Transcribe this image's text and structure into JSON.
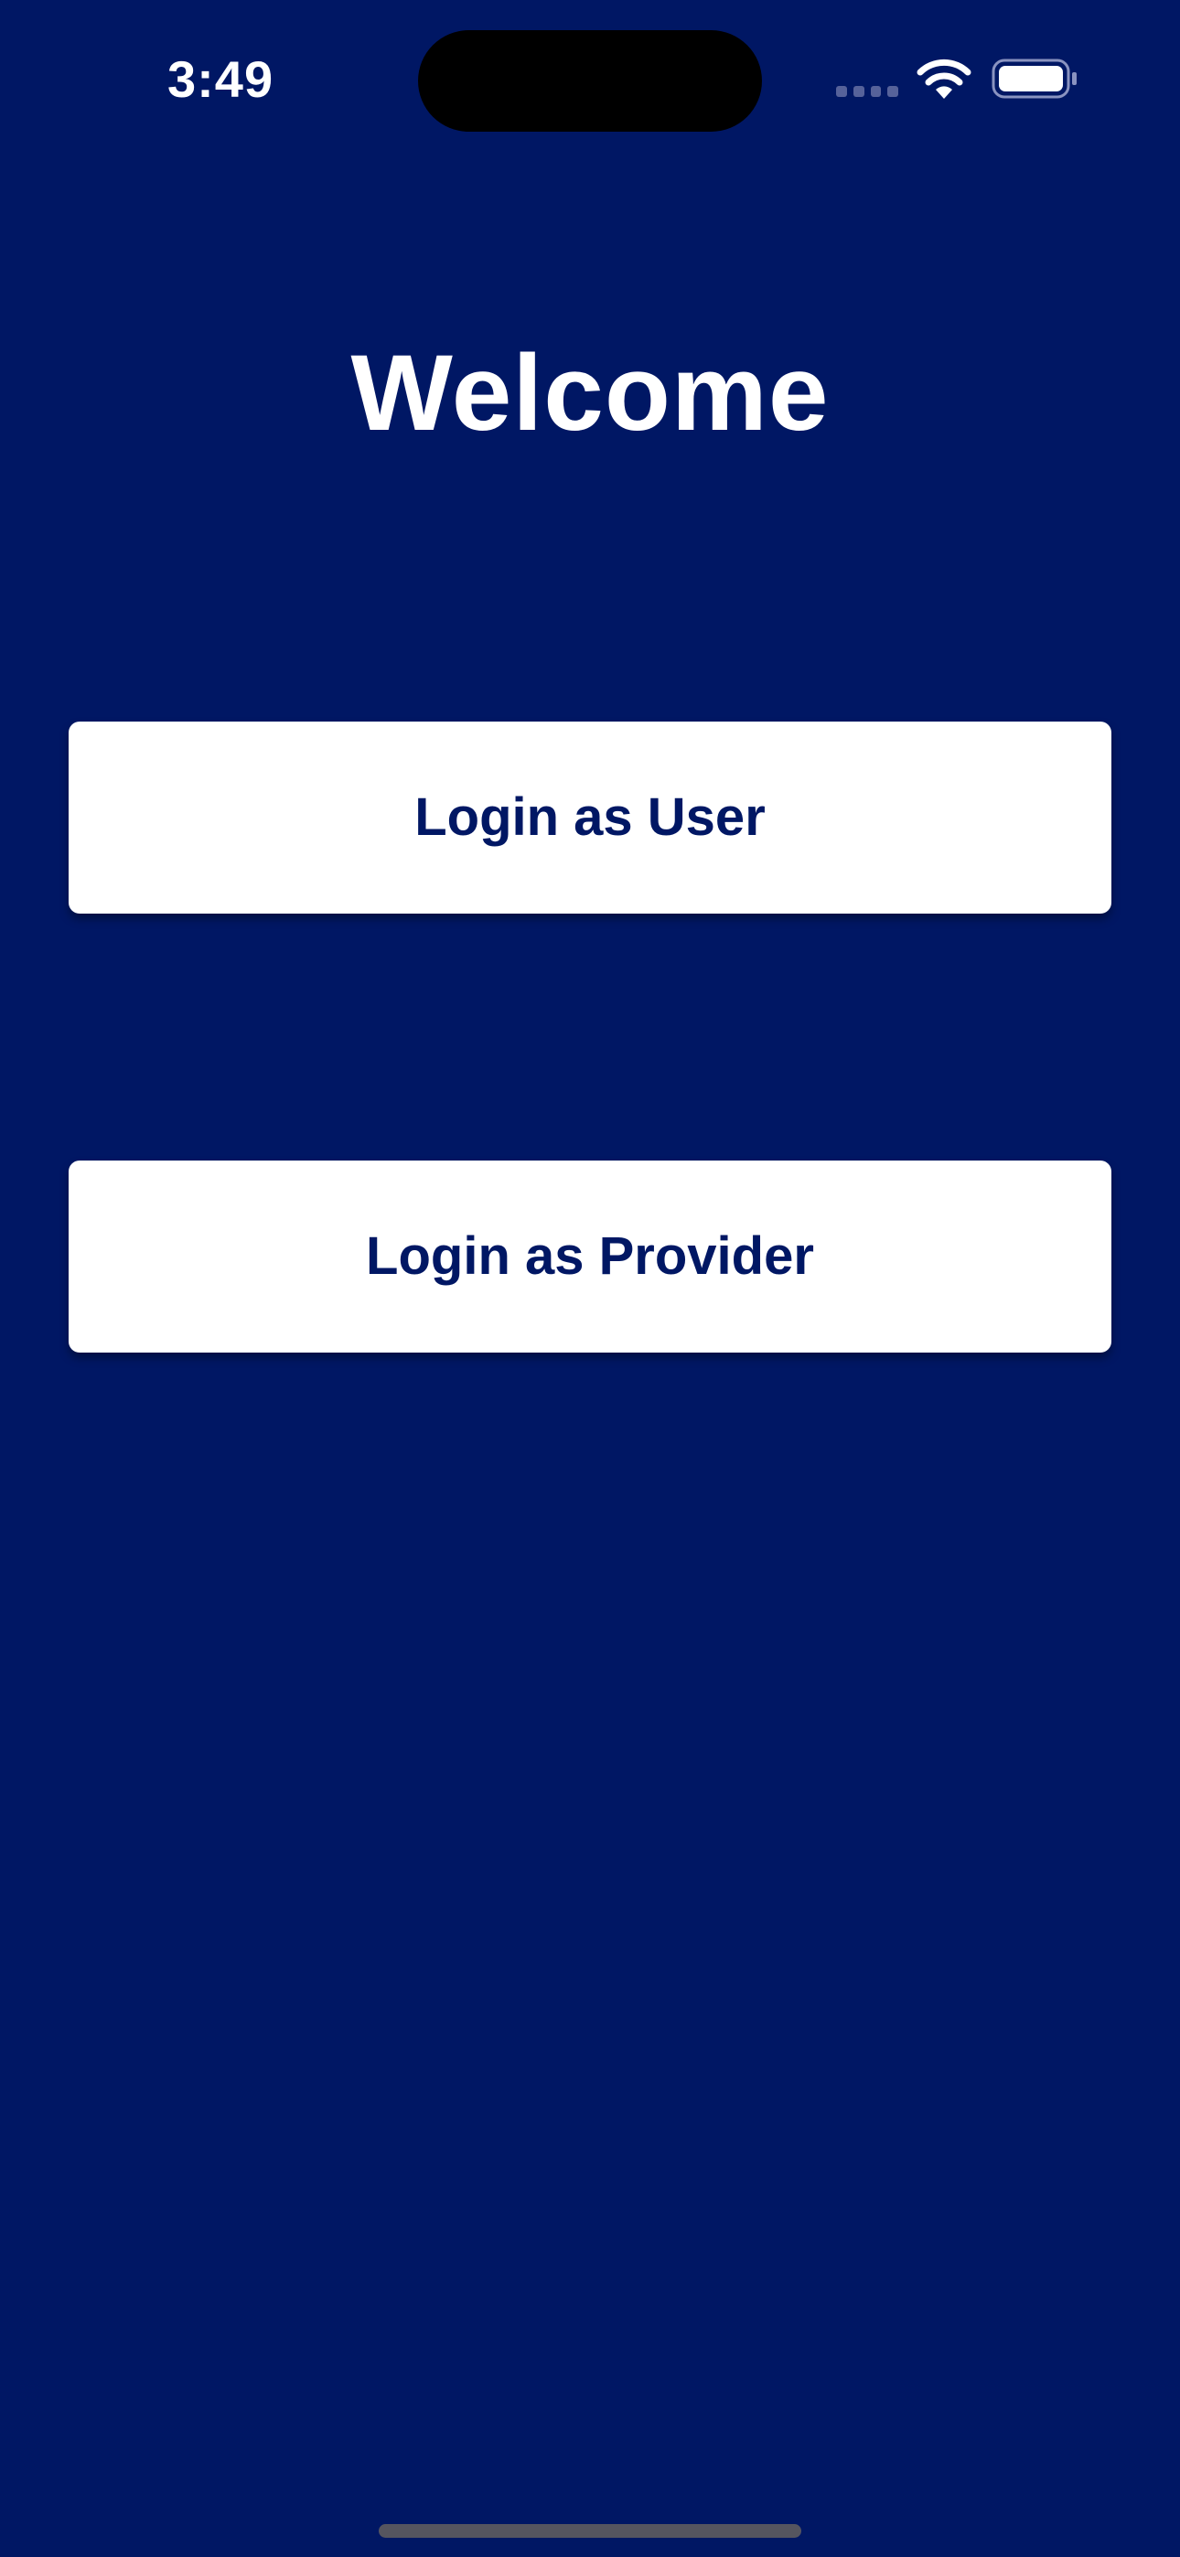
{
  "status_bar": {
    "time": "3:49",
    "icons": [
      "cellular-signal-icon",
      "wifi-icon",
      "battery-icon"
    ]
  },
  "main": {
    "title": "Welcome",
    "buttons": {
      "login_user": "Login as User",
      "login_provider": "Login as Provider"
    }
  },
  "colors": {
    "background": "#001764",
    "button_background": "#ffffff",
    "button_text": "#001764",
    "title_text": "#ffffff"
  }
}
